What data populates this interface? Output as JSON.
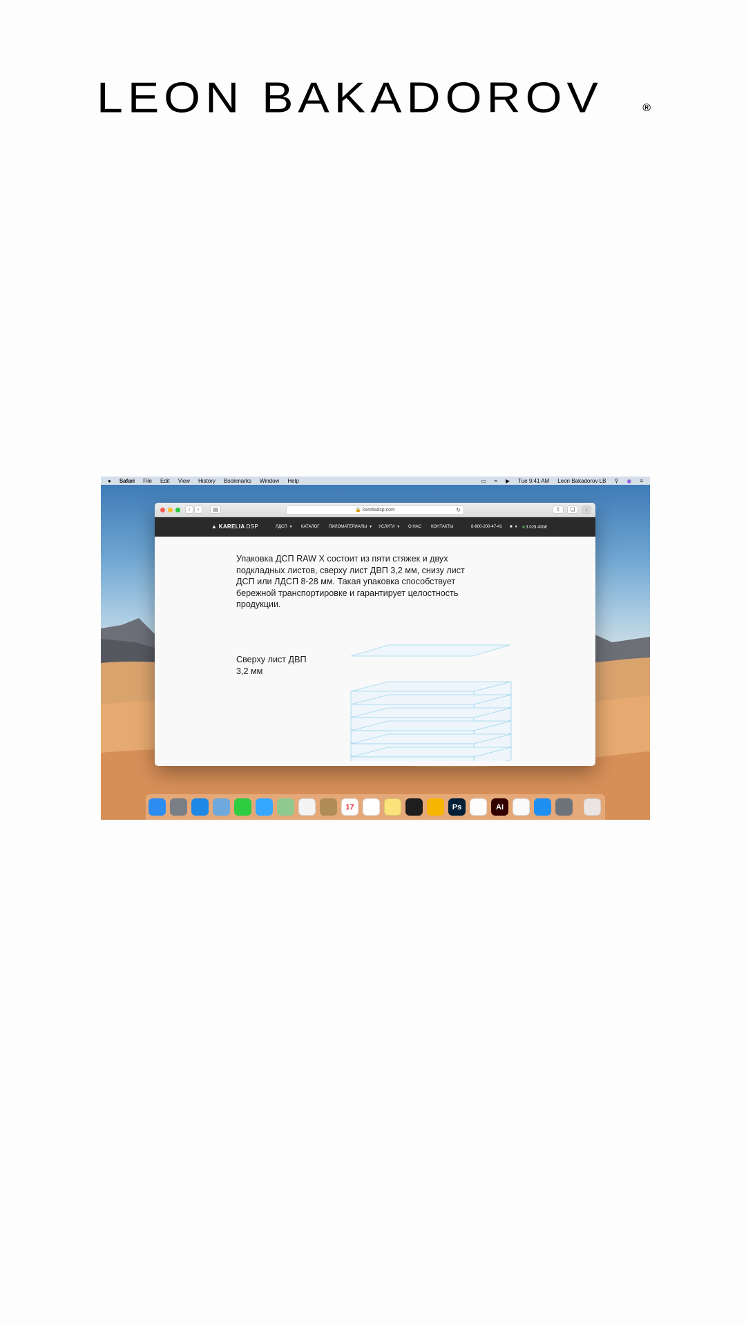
{
  "brand": {
    "name": "LEON BAKADOROV",
    "mark": "®"
  },
  "menubar": {
    "apple_icon": "apple-icon",
    "app": "Safari",
    "menus": [
      "File",
      "Edit",
      "View",
      "History",
      "Bookmarks",
      "Window",
      "Help"
    ],
    "clock": "Tue 9:41 AM",
    "user": "Leon Bakadorov LB",
    "icons": [
      "airplay-icon",
      "wifi-icon",
      "volume-icon",
      "search-icon",
      "siri-icon",
      "notification-center-icon"
    ]
  },
  "browser": {
    "url": "kareliadsp.com",
    "buttons": [
      "back-icon",
      "forward-icon",
      "sidebar-icon",
      "share-icon",
      "tabs-icon",
      "download-icon"
    ]
  },
  "site": {
    "logo": "KARELIA",
    "logo_suffix": "DSP",
    "nav": [
      "ЛДСП",
      "КАТАЛОГ",
      "ПИЛОМАТЕРИАЛЫ",
      "УСЛУГИ",
      "О НАС",
      "КОНТАКТЫ"
    ],
    "phone": "8-800-200-47-41",
    "cart": "3 029 400₽",
    "description": "Упаковка ДСП RAW X состоит из пяти стяжек и двух подкладных листов, сверху лист ДВП 3,2 мм, снизу лист ДСП или ЛДСП 8-28 мм. Такая упаковка способствует бережной транспортировке и гарантирует целостность продукции.",
    "top_sheet_label": "Сверху лист ДВП 3,2 мм",
    "layers_count": 6
  },
  "dock": {
    "apps": [
      {
        "name": "finder-icon",
        "color": "#2d8cf0",
        "glyph": ""
      },
      {
        "name": "launchpad-icon",
        "color": "#7a7f86",
        "glyph": ""
      },
      {
        "name": "safari-icon",
        "color": "#1e88e5",
        "glyph": ""
      },
      {
        "name": "preview-icon",
        "color": "#6fa8dc",
        "glyph": ""
      },
      {
        "name": "facetime-icon",
        "color": "#2ecc40",
        "glyph": ""
      },
      {
        "name": "messages-icon",
        "color": "#35a7ff",
        "glyph": ""
      },
      {
        "name": "maps-icon",
        "color": "#8fc98f",
        "glyph": ""
      },
      {
        "name": "photos-icon",
        "color": "#f4f4f4",
        "glyph": ""
      },
      {
        "name": "contacts-icon",
        "color": "#b08d57",
        "glyph": ""
      },
      {
        "name": "calendar-icon",
        "color": "#ffffff",
        "glyph": "17"
      },
      {
        "name": "reminders-icon",
        "color": "#ffffff",
        "glyph": ""
      },
      {
        "name": "notes-icon",
        "color": "#fbe27a",
        "glyph": ""
      },
      {
        "name": "figma-icon",
        "color": "#1e1e1e",
        "glyph": ""
      },
      {
        "name": "sketch-icon",
        "color": "#f7b500",
        "glyph": ""
      },
      {
        "name": "photoshop-icon",
        "color": "#001e36",
        "glyph": "Ps"
      },
      {
        "name": "itunes-icon",
        "color": "#fdfdfd",
        "glyph": ""
      },
      {
        "name": "illustrator-icon",
        "color": "#330000",
        "glyph": "Ai"
      },
      {
        "name": "numbers-icon",
        "color": "#fafafa",
        "glyph": ""
      },
      {
        "name": "app-store-icon",
        "color": "#1d8ff2",
        "glyph": ""
      },
      {
        "name": "system-preferences-icon",
        "color": "#6e737a",
        "glyph": ""
      }
    ],
    "trash": "trash-icon"
  }
}
